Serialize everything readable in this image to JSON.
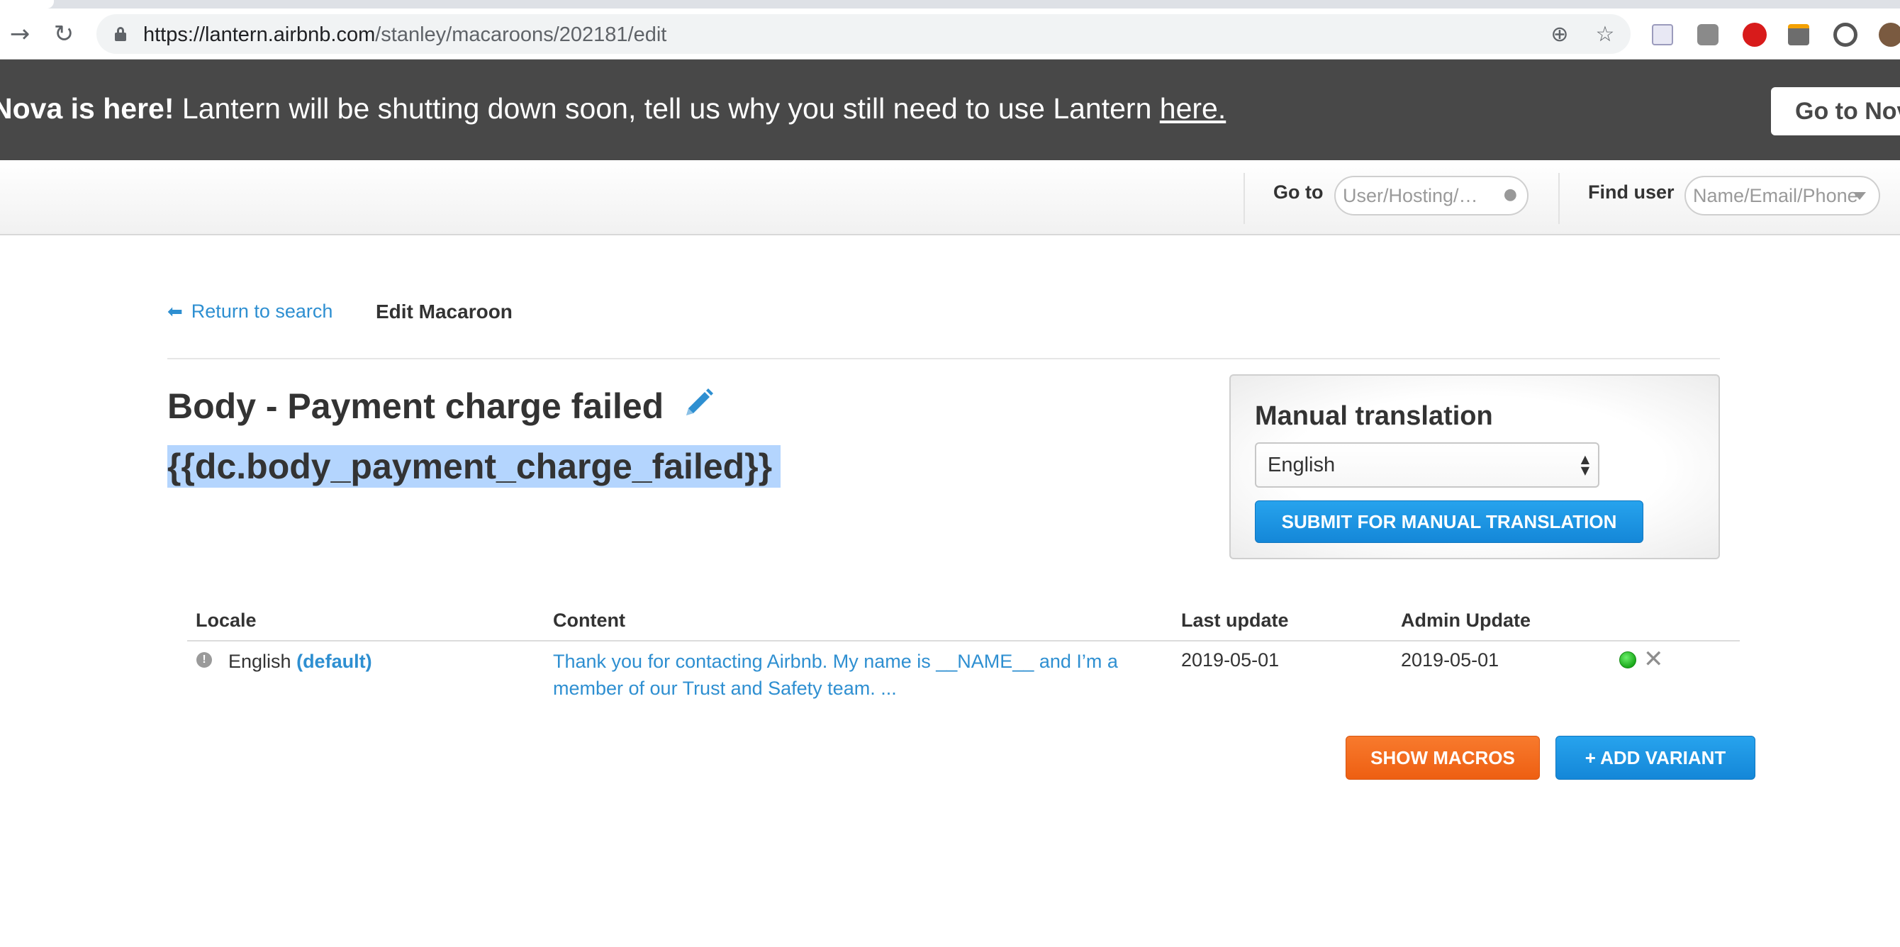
{
  "browser": {
    "url_host": "https://lantern.airbnb.com",
    "url_path": "/stanley/macaroons/202181/edit",
    "icons": {
      "back": "arrow-forward-icon",
      "reload": "reload-icon",
      "zoom": "zoom-icon",
      "bookmark": "star-icon"
    }
  },
  "banner": {
    "bold_text": "Nova is here!",
    "text": " Lantern will be shutting down soon, tell us why you still need to use Lantern ",
    "link_text": "here.",
    "cta_label": "Go to Nova"
  },
  "header": {
    "goto_label": "Go to",
    "goto_placeholder": "User/Hosting/…",
    "find_user_label": "Find user",
    "find_user_placeholder": "Name/Email/Phone"
  },
  "breadcrumb": {
    "back_label": "Return to search",
    "current": "Edit Macaroon"
  },
  "macaroon": {
    "title": "Body - Payment charge failed",
    "key": "{{dc.body_payment_charge_failed}}"
  },
  "manual_translation": {
    "title": "Manual translation",
    "selected_language": "English",
    "submit_label": "SUBMIT FOR MANUAL TRANSLATION"
  },
  "locales_table": {
    "columns": [
      "Locale",
      "Content",
      "Last update",
      "Admin Update"
    ],
    "rows": [
      {
        "locale": "English",
        "default_tag": "(default)",
        "content": "Thank you for contacting Airbnb. My name is __NAME__ and I’m a member of our Trust and Safety team. ...",
        "last_update": "2019-05-01",
        "admin_update": "2019-05-01"
      }
    ]
  },
  "actions": {
    "show_macros_label": "SHOW MACROS",
    "add_variant_label": "+ ADD VARIANT"
  },
  "colors": {
    "link": "#2e8fd1",
    "primary_button": "#1a96e2",
    "orange_button": "#f26a1e",
    "banner_bg": "#484848",
    "selection": "#b4d5fe",
    "status_ok": "#1ba91b"
  }
}
